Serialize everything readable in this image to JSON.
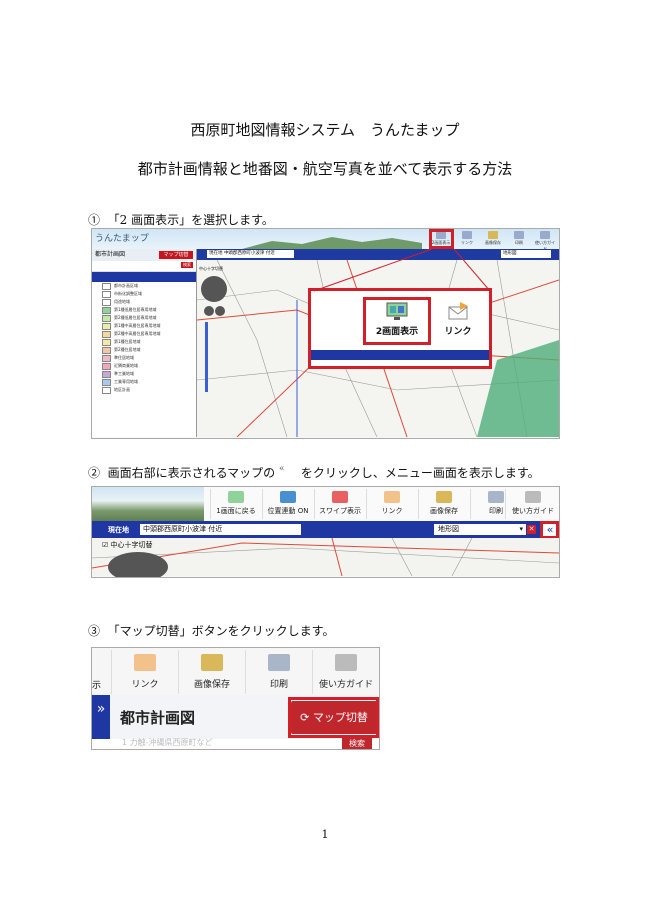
{
  "document": {
    "title": "西原町地図情報システム　うんたまップ",
    "subtitle": "都市計画情報と地番図・航空写真を並べて表示する方法",
    "page_number": "1"
  },
  "steps": [
    {
      "marker": "①",
      "text": "「2 画面表示」を選択します。"
    },
    {
      "marker": "②",
      "text_before": "画面右部に表示されるマップの",
      "text_after": "をクリックし、メニュー画面を表示します。"
    },
    {
      "marker": "③",
      "text": "「マップ切替」ボタンをクリックします。"
    }
  ],
  "shot1": {
    "brand": "うんたまップ",
    "toolbar": [
      "2画面表示",
      "リンク",
      "画像保存",
      "印刷",
      "使い方ガイド"
    ],
    "panel_title": "都市計画図",
    "map_switch": "マップ切替",
    "search": "検索",
    "location_label": "現在地",
    "location_value": "中頭郡西原町小波津 付近",
    "basemap": "地形図",
    "legend_items": [
      "都市計画区域",
      "市街化調整区域",
      "用途地域",
      "第1種低層住居専用地域",
      "第2種低層住居専用地域",
      "第1種中高層住居専用地域",
      "第2種中高層住居専用地域",
      "第1種住居地域",
      "第2種住居地域",
      "準住居地域",
      "近隣商業地域",
      "準工業地域",
      "工業専用地域",
      "地区計画"
    ],
    "legend_colors": [
      "#ffffff",
      "#ffffff",
      "#ffffff",
      "#8fd39b",
      "#c3e8a7",
      "#e6efaa",
      "#f5d7a1",
      "#f4e8a8",
      "#f3c4a5",
      "#f0b9c7",
      "#f3a7b7",
      "#c6a9d9",
      "#a8c8f0",
      "#ffffff"
    ],
    "crosshair_label": "中心十字切替",
    "callout_buttons": [
      "2画面表示",
      "リンク"
    ]
  },
  "shot2": {
    "toolbar": [
      "1画面に戻る",
      "位置連動 ON",
      "スワイプ表示",
      "リンク",
      "画像保存",
      "印刷",
      "使い方ガイド"
    ],
    "location_label": "現在地",
    "location_value": "中頭郡西原町小波津 付近",
    "basemap": "地形図",
    "collapse_glyph": "«",
    "crosshair_label": "中心十字切替"
  },
  "shot3": {
    "toolbar_partial": "示",
    "toolbar": [
      "リンク",
      "画像保存",
      "印刷",
      "使い方ガイド"
    ],
    "expand_glyph": "»",
    "panel_title": "都市計画図",
    "map_switch": "マップ切替",
    "search_placeholder": "1 力触-沖縄県西原町など",
    "search": "検索"
  },
  "colors": {
    "accent_red": "#d2202a",
    "bar_blue": "#1e37a3"
  }
}
